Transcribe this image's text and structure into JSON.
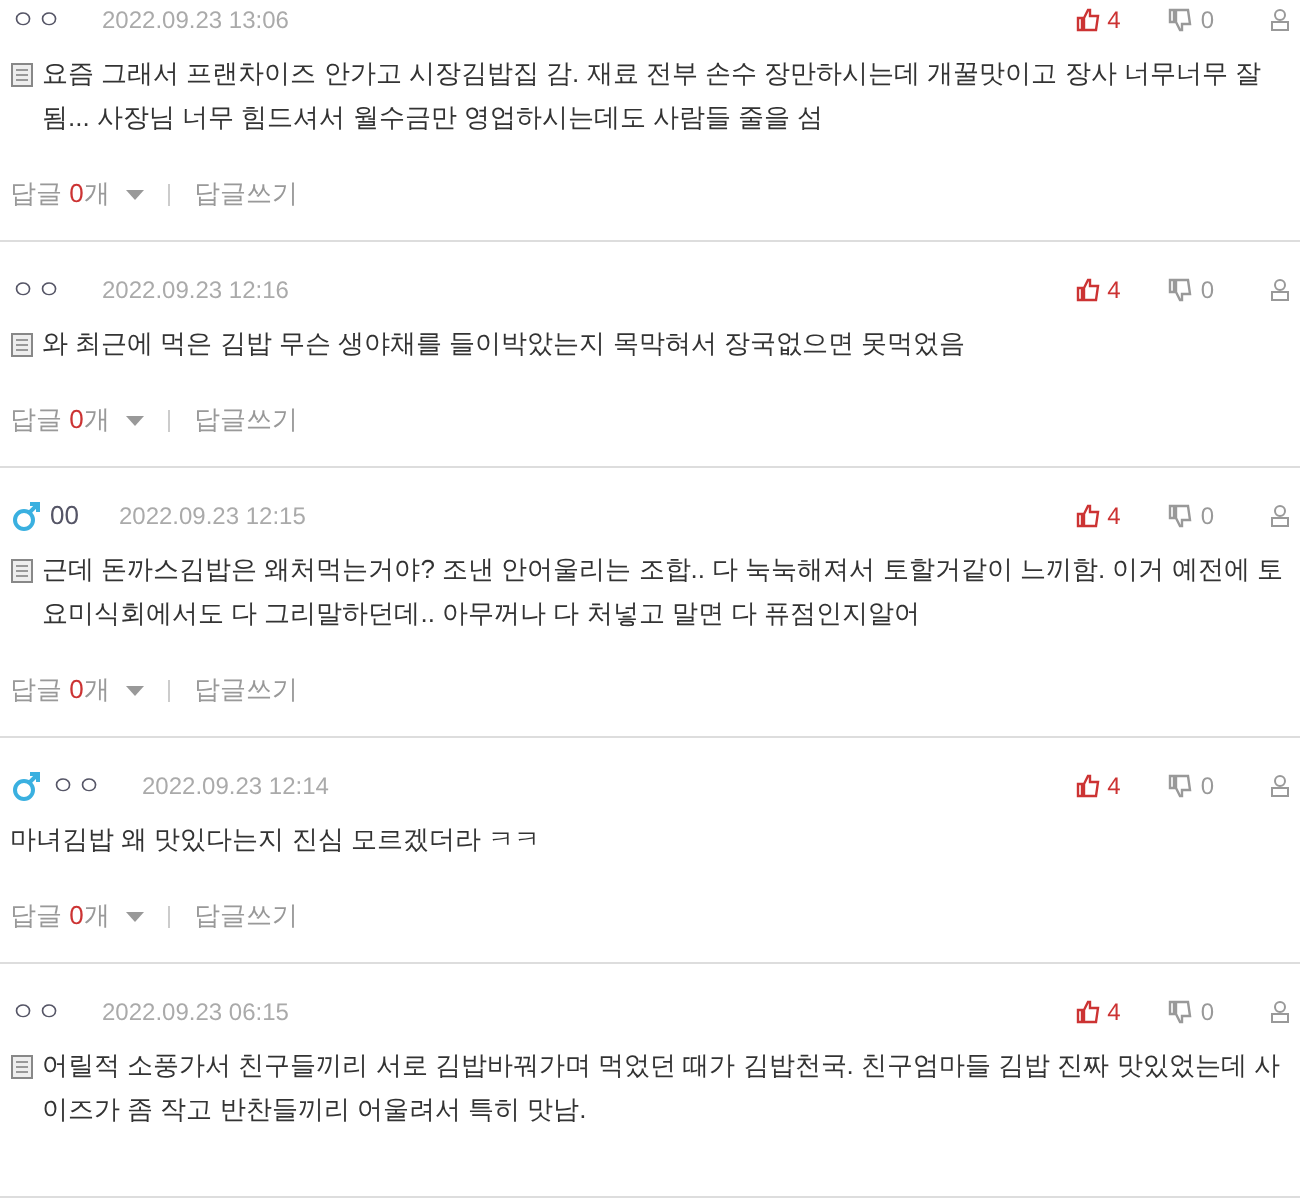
{
  "comments": [
    {
      "male": false,
      "nickname": "ㅇㅇ",
      "date": "2022.09.23 13:06",
      "likes": "4",
      "dislikes": "0",
      "memo": true,
      "text": "요즘 그래서 프랜차이즈 안가고 시장김밥집 감. 재료 전부 손수 장만하시는데 개꿀맛이고 장사 너무너무 잘됨... 사장님 너무 힘드셔서 월수금만 영업하시는데도 사람들 줄을 섬",
      "reply_label": "답글",
      "reply_count": "0",
      "reply_unit": "개",
      "write_label": "답글쓰기"
    },
    {
      "male": false,
      "nickname": "ㅇㅇ",
      "date": "2022.09.23 12:16",
      "likes": "4",
      "dislikes": "0",
      "memo": true,
      "text": "와 최근에 먹은 김밥 무슨 생야채를 들이박았는지 목막혀서 장국없으면 못먹었음",
      "reply_label": "답글",
      "reply_count": "0",
      "reply_unit": "개",
      "write_label": "답글쓰기"
    },
    {
      "male": true,
      "nickname": "00",
      "date": "2022.09.23 12:15",
      "likes": "4",
      "dislikes": "0",
      "memo": true,
      "text": "근데 돈까스김밥은 왜처먹는거야? 조낸 안어울리는 조합.. 다 눅눅해져서 토할거같이 느끼함. 이거 예전에 토요미식회에서도 다 그리말하던데.. 아무꺼나 다 처넣고 말면 다 퓨점인지알어",
      "reply_label": "답글",
      "reply_count": "0",
      "reply_unit": "개",
      "write_label": "답글쓰기"
    },
    {
      "male": true,
      "nickname": "ㅇㅇ",
      "date": "2022.09.23 12:14",
      "likes": "4",
      "dislikes": "0",
      "memo": false,
      "text": "마녀김밥 왜 맛있다는지 진심 모르겠더라 ㅋㅋ",
      "reply_label": "답글",
      "reply_count": "0",
      "reply_unit": "개",
      "write_label": "답글쓰기"
    },
    {
      "male": false,
      "nickname": "ㅇㅇ",
      "date": "2022.09.23 06:15",
      "likes": "4",
      "dislikes": "0",
      "memo": true,
      "text": "어릴적 소풍가서 친구들끼리 서로 김밥바꿔가며 먹었던 때가 김밥천국. 친구엄마들 김밥 진짜 맛있었는데 사이즈가 좀 작고 반찬들끼리 어울려서 특히 맛남."
    }
  ]
}
